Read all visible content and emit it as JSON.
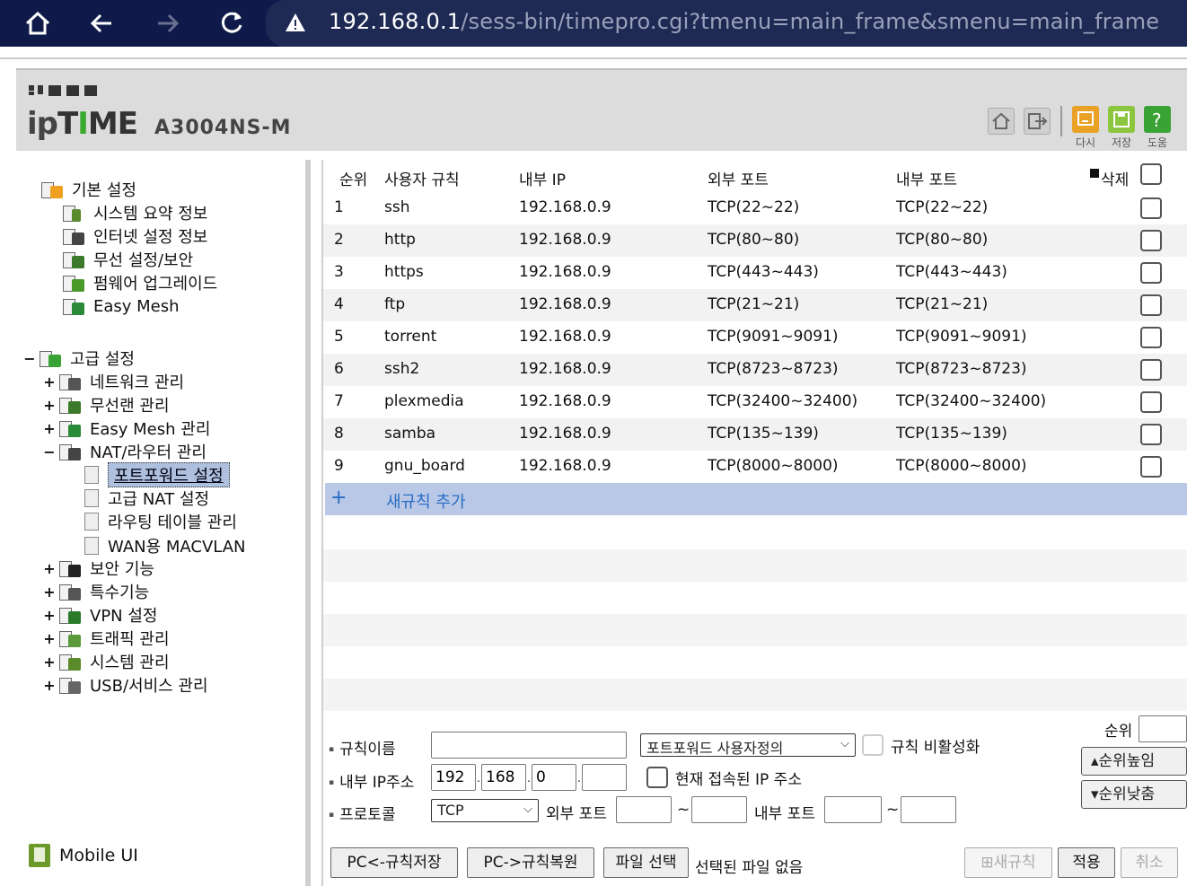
{
  "browser": {
    "url_host": "192.168.0.1",
    "url_path": "/sess-bin/timepro.cgi?tmenu=main_frame&smenu=main_frame"
  },
  "header": {
    "brand": "ipTIME",
    "model": "A3004NS-M",
    "actions": [
      {
        "label": "다시",
        "icon": "undo-icon",
        "color": "#e9a126"
      },
      {
        "label": "저장",
        "icon": "save-icon",
        "color": "#8cc63f"
      },
      {
        "label": "도움",
        "icon": "help-icon",
        "color": "#3aa335"
      }
    ]
  },
  "sidebar": {
    "basic": {
      "label": "기본 설정",
      "items": [
        "시스템 요약 정보",
        "인터넷 설정 정보",
        "무선 설정/보안",
        "펌웨어 업그레이드",
        "Easy Mesh"
      ]
    },
    "advanced": {
      "label": "고급 설정",
      "items": [
        "네트워크 관리",
        "무선랜 관리",
        "Easy Mesh 관리",
        "NAT/라우터 관리",
        "보안 기능",
        "특수기능",
        "VPN 설정",
        "트래픽 관리",
        "시스템 관리",
        "USB/서비스 관리"
      ],
      "nat_children": [
        "포트포워드 설정",
        "고급 NAT 설정",
        "라우팅 테이블 관리",
        "WAN용 MACVLAN"
      ]
    },
    "mobile_ui": "Mobile UI"
  },
  "table": {
    "headers": {
      "order": "순위",
      "name": "사용자 규칙",
      "ip": "내부 IP",
      "ext": "외부 포트",
      "int": "내부 포트",
      "del": "삭제"
    },
    "rows": [
      {
        "order": "1",
        "name": "ssh",
        "ip": "192.168.0.9",
        "ext": "TCP(22~22)",
        "int": "TCP(22~22)"
      },
      {
        "order": "2",
        "name": "http",
        "ip": "192.168.0.9",
        "ext": "TCP(80~80)",
        "int": "TCP(80~80)"
      },
      {
        "order": "3",
        "name": "https",
        "ip": "192.168.0.9",
        "ext": "TCP(443~443)",
        "int": "TCP(443~443)"
      },
      {
        "order": "4",
        "name": "ftp",
        "ip": "192.168.0.9",
        "ext": "TCP(21~21)",
        "int": "TCP(21~21)"
      },
      {
        "order": "5",
        "name": "torrent",
        "ip": "192.168.0.9",
        "ext": "TCP(9091~9091)",
        "int": "TCP(9091~9091)"
      },
      {
        "order": "6",
        "name": "ssh2",
        "ip": "192.168.0.9",
        "ext": "TCP(8723~8723)",
        "int": "TCP(8723~8723)"
      },
      {
        "order": "7",
        "name": "plexmedia",
        "ip": "192.168.0.9",
        "ext": "TCP(32400~32400)",
        "int": "TCP(32400~32400)"
      },
      {
        "order": "8",
        "name": "samba",
        "ip": "192.168.0.9",
        "ext": "TCP(135~139)",
        "int": "TCP(135~139)"
      },
      {
        "order": "9",
        "name": "gnu_board",
        "ip": "192.168.0.9",
        "ext": "TCP(8000~8000)",
        "int": "TCP(8000~8000)"
      }
    ],
    "add_rule": "새규칙 추가"
  },
  "form": {
    "rule_name_label": "규칙이름",
    "rule_name_value": "",
    "preset_select": "포트포워드 사용자정의",
    "disable_label": "규칙 비활성화",
    "ip_label": "내부 IP주소",
    "ip": [
      "192",
      "168",
      "0",
      ""
    ],
    "current_ip_label": "현재 접속된 IP 주소",
    "protocol_label": "프로토콜",
    "protocol_value": "TCP",
    "ext_port_label": "외부 포트",
    "int_port_label": "내부 포트",
    "tilde": "~",
    "order_label": "순위",
    "order_up": "순위높임",
    "order_down": "순위낮춤",
    "pc_save": "PC<-규칙저장",
    "pc_restore": "PC->규칙복원",
    "file_select": "파일 선택",
    "file_status": "선택된 파일 없음",
    "new_rule": "새규칙",
    "apply": "적용",
    "cancel": "취소"
  }
}
